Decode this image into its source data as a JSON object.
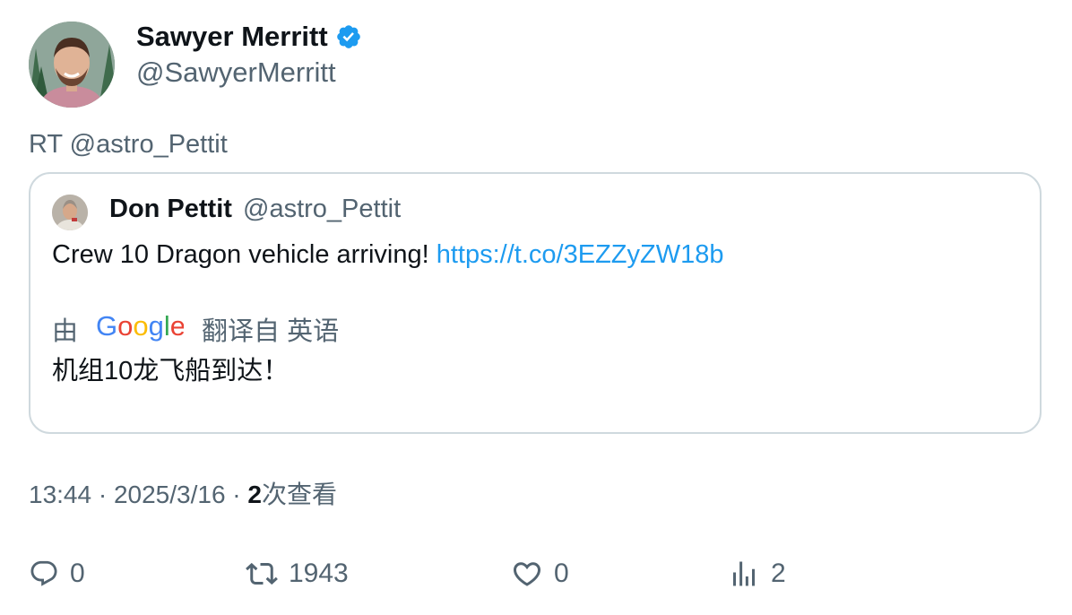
{
  "author": {
    "name": "Sawyer Merritt",
    "handle": "@SawyerMerritt",
    "verified": true,
    "verified_color": "#1d9bf0"
  },
  "retweet_line": "RT @astro_Pettit",
  "quoted": {
    "name": "Don Pettit",
    "handle": "@astro_Pettit",
    "text": "Crew 10 Dragon vehicle arriving! ",
    "link": "https://t.co/3EZZyZW18b",
    "translation": {
      "prefix": "由",
      "provider": "Google",
      "suffix": "翻译自 英语",
      "text": "机组10龙飞船到达！"
    }
  },
  "meta": {
    "time": "13:44 · 2025/3/16 · ",
    "views_count": "2",
    "views_label": "次查看"
  },
  "actions": {
    "replies": "0",
    "retweets": "1943",
    "likes": "0",
    "views": "2"
  },
  "colors": {
    "text": "#0f1419",
    "secondary": "#536471",
    "link": "#1d9bf0",
    "border": "#cfd9de"
  }
}
